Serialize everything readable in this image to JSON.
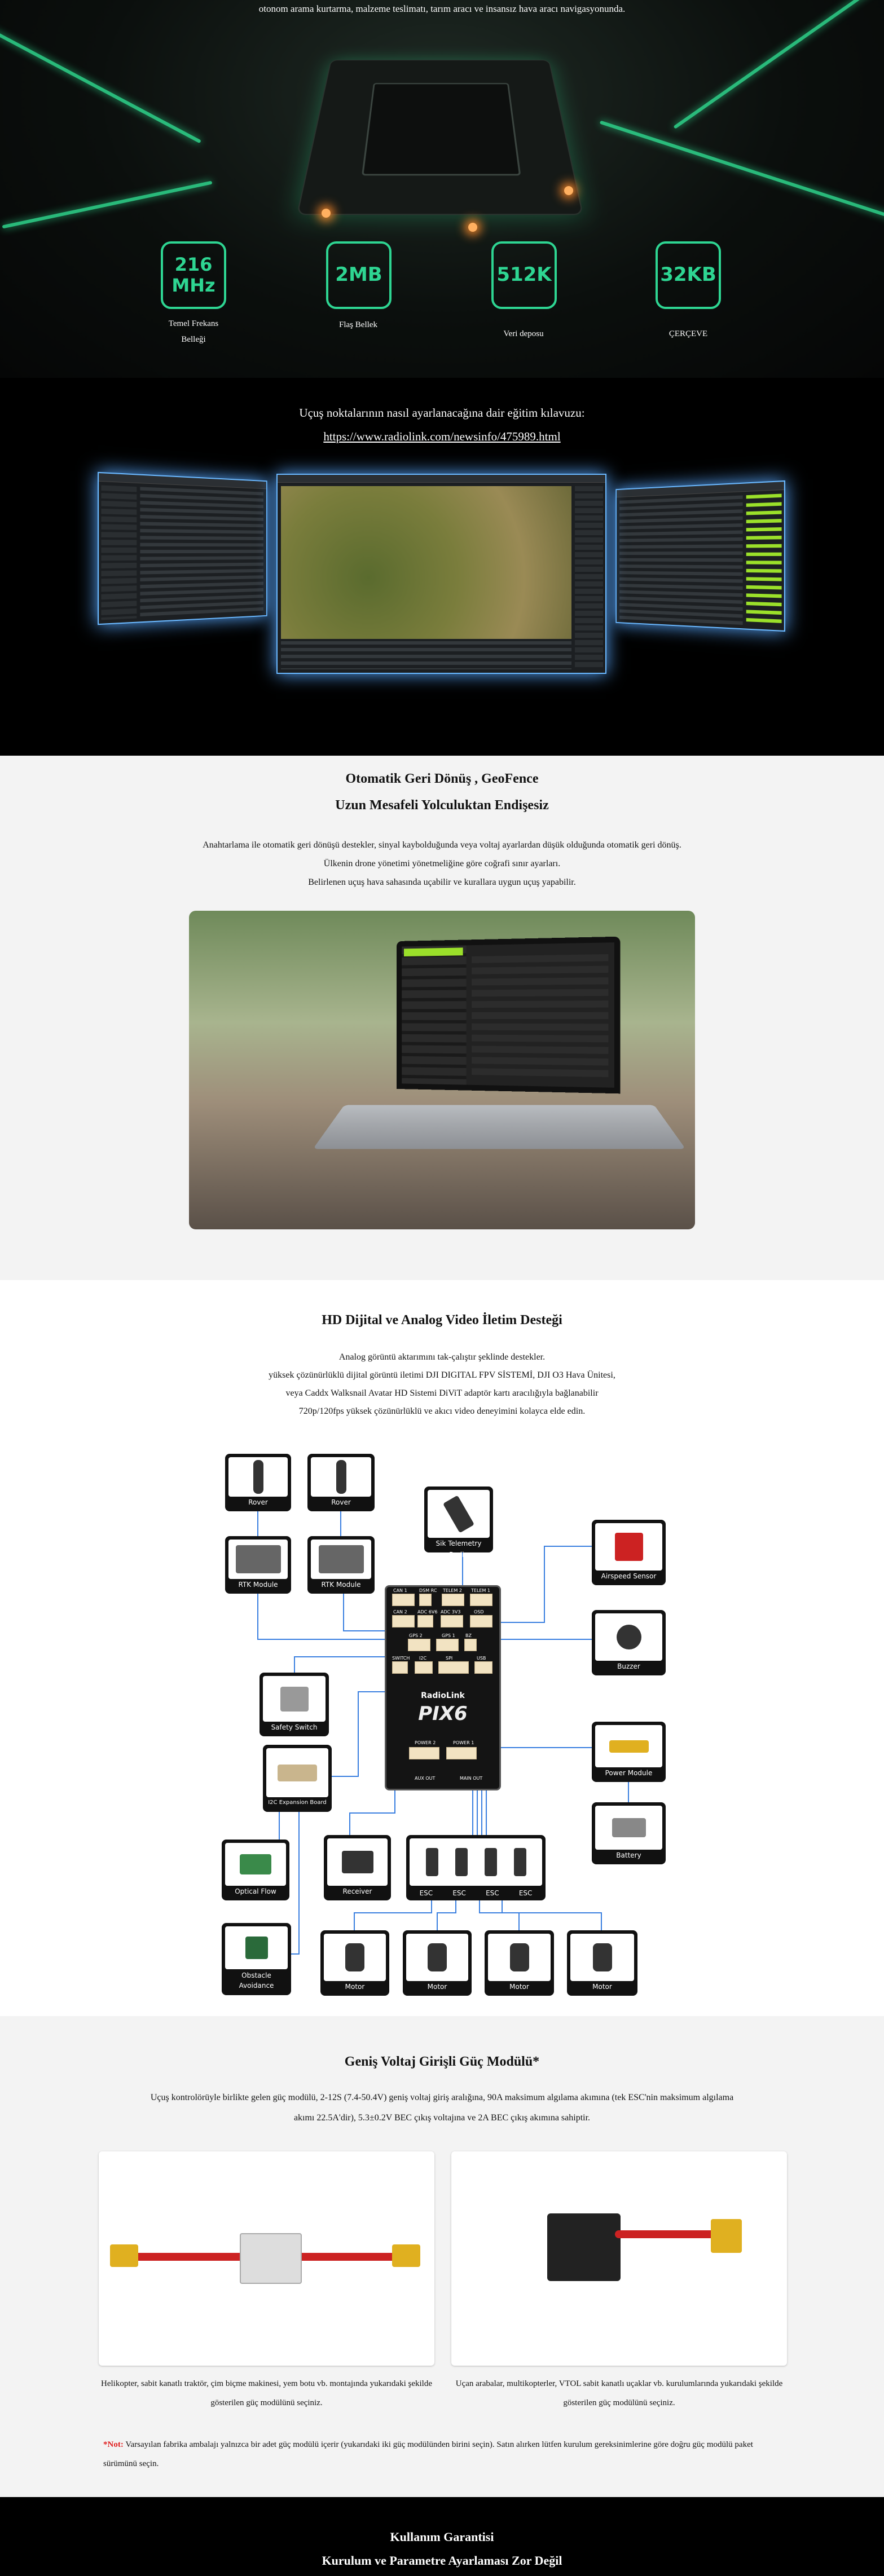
{
  "hero": {
    "text": "otonom arama kurtarma, malzeme teslimatı, tarım aracı ve insansız hava aracı navigasyonunda.",
    "accent": "#2ed592",
    "stats": [
      {
        "value": "216 MHz",
        "label": "Temel Frekans Belleği"
      },
      {
        "value": "2MB",
        "label": "Flaş Bellek"
      },
      {
        "value": "512K",
        "label": "Veri deposu"
      },
      {
        "value": "32KB",
        "label": "ÇERÇEVE"
      }
    ]
  },
  "guide": {
    "text": "Uçuş noktalarının nasıl ayarlanacağına dair eğitim kılavuzu:",
    "link": "https://www.radiolink.com/newsinfo/475989.html"
  },
  "geofence": {
    "title1": "Otomatik Geri Dönüş , GeoFence",
    "title2": "Uzun Mesafeli Yolculuktan Endişesiz",
    "paragraphs": [
      "Anahtarlama ile otomatik geri dönüşü destekler, sinyal kaybolduğunda veya voltaj ayarlardan düşük olduğunda otomatik geri dönüş.",
      "Ülkenin drone yönetimi yönetmeliğine göre coğrafi sınır ayarları.",
      "Belirlenen uçuş hava sahasında uçabilir ve kurallara uygun uçuş yapabilir."
    ]
  },
  "video": {
    "title": "HD Dijital ve Analog Video İletim Desteği",
    "paragraphs": [
      "Analog görüntü aktarımını tak-çalıştır şeklinde destekler.",
      "yüksek çözünürlüklü dijital görüntü iletimi DJI DIGITAL FPV SİSTEMİ, DJI O3 Hava Ünitesi,",
      "veya Caddx Walksnail Avatar HD Sistemi DiViT adaptör kartı aracılığıyla bağlanabilir",
      "720p/120fps yüksek çözünürlüklü ve akıcı video deneyimini kolayca elde edin."
    ]
  },
  "diagram": {
    "board_brand": "RadioLink",
    "board_name": "PIX6",
    "line_color": "#3a7fe0",
    "nodes": {
      "rover1": "Rover",
      "rover2": "Rover",
      "rtk1": "RTK Module",
      "rtk2": "RTK Module",
      "sik": "Sik Telemetry Radio",
      "airspeed": "Airspeed Sensor",
      "buzzer": "Buzzer",
      "safety": "Safety Switch",
      "i2c": "I2C Expansion Board",
      "power": "Power Module",
      "battery": "Battery",
      "optical": "Optical Flow",
      "receiver": "Receiver",
      "esc": [
        "ESC",
        "ESC",
        "ESC",
        "ESC"
      ],
      "obstacle": "Obstacle Avoidance",
      "motors": [
        "Motor",
        "Motor",
        "Motor",
        "Motor"
      ]
    },
    "ports": [
      "CAN 1",
      "DSM RC",
      "TELEM 2",
      "TELEM 1",
      "CAN 2",
      "ADC 6V6",
      "ADC 3V3",
      "OSD",
      "GPS 2",
      "GPS 1",
      "BZ",
      "SWITCH",
      "I2C",
      "SPI",
      "USB",
      "POWER 2",
      "POWER 1",
      "AUX OUT",
      "MAIN OUT"
    ]
  },
  "power": {
    "title": "Geniş Voltaj Girişli Güç Modülü*",
    "paragraphs": [
      "Uçuş kontrolörüyle birlikte gelen güç modülü, 2-12S (7.4-50.4V) geniş voltaj giriş aralığına, 90A maksimum algılama akımına (tek ESC'nin maksimum algılama",
      "akımı 22.5A'dir), 5.3±0.2V BEC çıkış voltajına ve 2A BEC çıkış akımına sahiptir."
    ],
    "captions": [
      "Helikopter, sabit kanatlı traktör, çim biçme makinesi, yem botu vb. montajında yukarıdaki şekilde gösterilen güç modülünü seçiniz.",
      "Uçan arabalar, multikopterler, VTOL sabit kanatlı uçaklar vb. kurulumlarında yukarıdaki şekilde gösterilen güç modülünü seçiniz."
    ],
    "note_label": "*Not:",
    "note_color": "#e02020",
    "note": "Varsayılan fabrika ambalajı yalnızca bir adet güç modülü içerir (yukarıdaki iki güç modülünden birini seçin). Satın alırken lütfen kurulum gereksinimlerine göre doğru güç modülü paket sürümünü seçin."
  },
  "footer": {
    "title1": "Kullanım Garantisi",
    "title2": "Kurulum ve Parametre Ayarlaması Zor Değil"
  }
}
